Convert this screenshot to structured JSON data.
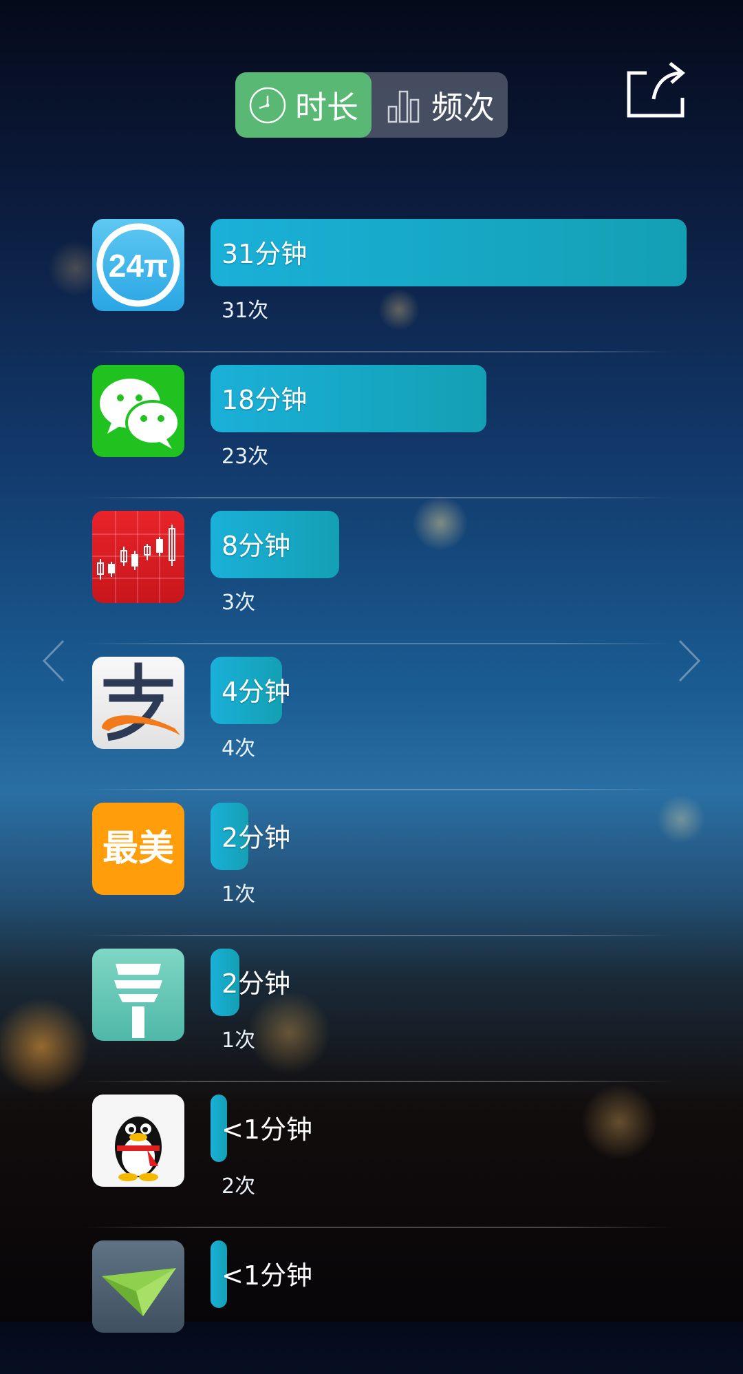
{
  "tabs": [
    {
      "label": "时长",
      "icon": "clock-icon",
      "active": true
    },
    {
      "label": "频次",
      "icon": "bar-chart-icon",
      "active": false
    }
  ],
  "share_icon": "share-icon",
  "apps": [
    {
      "icon": "24pi-app-icon",
      "duration": "31分钟",
      "count": "31次",
      "bar_fraction": 1.0
    },
    {
      "icon": "wechat-app-icon",
      "duration": "18分钟",
      "count": "23次",
      "bar_fraction": 0.58
    },
    {
      "icon": "stock-chart-app-icon",
      "duration": "8分钟",
      "count": "3次",
      "bar_fraction": 0.27
    },
    {
      "icon": "alipay-app-icon",
      "duration": "4分钟",
      "count": "4次",
      "bar_fraction": 0.15
    },
    {
      "icon": "zuimei-app-icon",
      "duration": "2分钟",
      "count": "1次",
      "bar_fraction": 0.08
    },
    {
      "icon": "control-tower-app-icon",
      "duration": "2分钟",
      "count": "1次",
      "bar_fraction": 0.06
    },
    {
      "icon": "qq-penguin-app-icon",
      "duration": "<1分钟",
      "count": "2次",
      "bar_fraction": 0.03
    },
    {
      "icon": "paper-plane-app-icon",
      "duration": "<1分钟",
      "count": "",
      "bar_fraction": 0.03
    }
  ],
  "icon_text": {
    "app0": "24π",
    "app4": "最美"
  },
  "arrows": {
    "left": "chevron-left-icon",
    "right": "chevron-right-icon"
  }
}
